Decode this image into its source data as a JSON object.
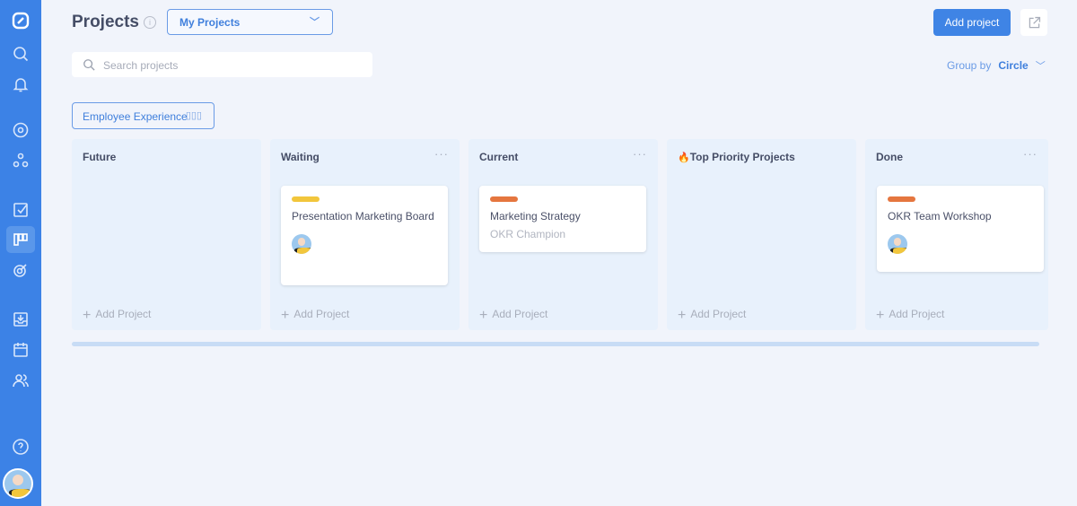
{
  "header": {
    "title": "Projects",
    "info_icon": "i",
    "filter_value": "My Projects",
    "add_button": "Add project"
  },
  "search": {
    "placeholder": "Search projects"
  },
  "group_by": {
    "label": "Group by",
    "value": "Circle"
  },
  "circle": {
    "name": "Employee Experience"
  },
  "columns": [
    {
      "title": "Future",
      "cards": []
    },
    {
      "title": "Waiting",
      "cards": [
        {
          "title": "Presentation Marketing Board",
          "color": "#f2c63c"
        }
      ]
    },
    {
      "title": "Current",
      "cards": [
        {
          "title": "Marketing Strategy",
          "subtitle": "OKR Champion",
          "color": "#e5763f"
        }
      ]
    },
    {
      "title": "Top Priority Projects",
      "emoji": "🔥",
      "cards": []
    },
    {
      "title": "Done",
      "cards": [
        {
          "title": "OKR Team Workshop",
          "color": "#e5763f"
        }
      ]
    }
  ],
  "add_project_label": "Add Project",
  "more": "···"
}
